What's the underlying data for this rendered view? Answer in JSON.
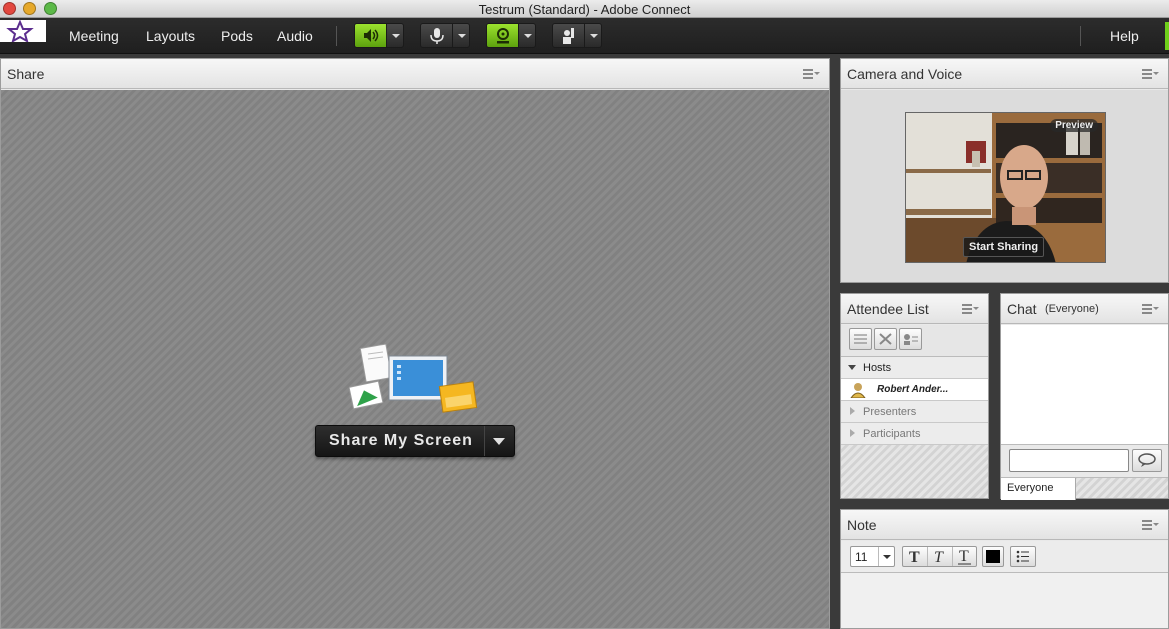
{
  "window": {
    "title": "Testrum (Standard) - Adobe Connect"
  },
  "menu": {
    "items": [
      "Meeting",
      "Layouts",
      "Pods",
      "Audio"
    ],
    "help": "Help"
  },
  "colors": {
    "accent_green": "#8ad21a",
    "menubar": "#262626",
    "hatch": "#868686"
  },
  "toolbar": {
    "icons": [
      "speaker-icon",
      "microphone-icon",
      "webcam-icon",
      "raise-hand-icon"
    ]
  },
  "share_pod": {
    "title": "Share",
    "button_label": "Share My Screen"
  },
  "camera_pod": {
    "title": "Camera and Voice",
    "preview_label": "Preview",
    "start_button": "Start Sharing"
  },
  "attendee_pod": {
    "title": "Attendee List",
    "groups": [
      {
        "label": "Hosts",
        "expanded": true,
        "members": [
          "Robert Ander..."
        ]
      },
      {
        "label": "Presenters",
        "expanded": false,
        "members": []
      },
      {
        "label": "Participants",
        "expanded": false,
        "members": []
      }
    ]
  },
  "chat_pod": {
    "title": "Chat",
    "scope": "(Everyone)",
    "input_value": "",
    "tab_label": "Everyone"
  },
  "note_pod": {
    "title": "Note",
    "font_size": "11"
  }
}
